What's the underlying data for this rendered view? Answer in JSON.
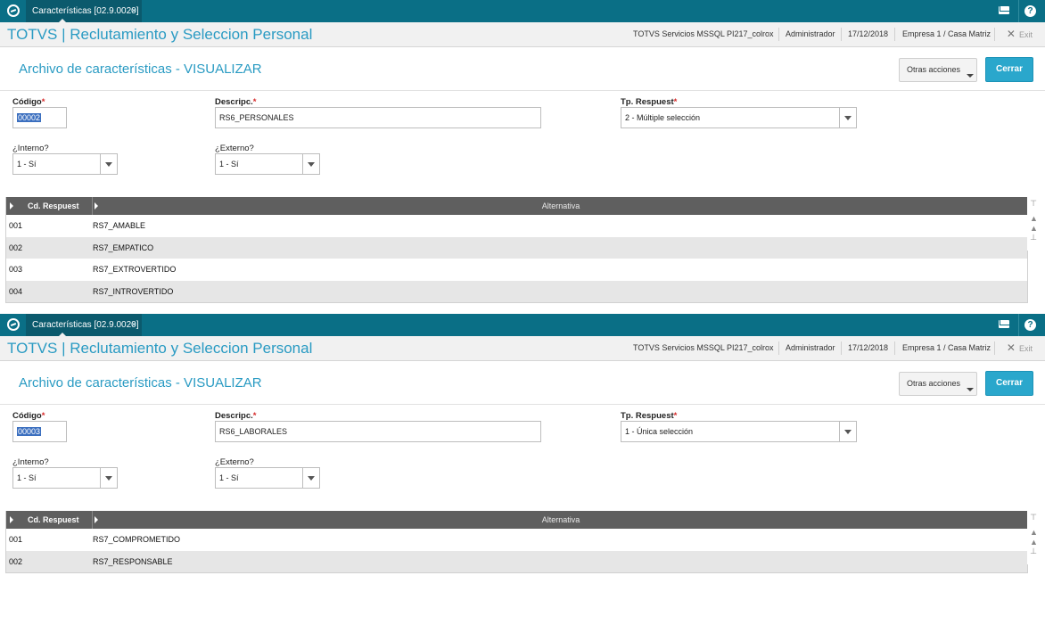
{
  "colors": {
    "topbar": "#0a6f86",
    "accent": "#2a9bc3",
    "primary_button": "#2aa7cc",
    "grid_header": "#5f5f5f"
  },
  "screens": [
    {
      "tab_label": "Características [02.9.0020]",
      "tab_close": "×",
      "app_title": "TOTVS | Reclutamiento y Seleccion Personal",
      "env": "TOTVS Servicios MSSQL PI217_colrox",
      "user": "Administrador",
      "date": "17/12/2018",
      "company": "Empresa 1 / Casa Matriz",
      "exit": "Exit",
      "page_title": "Archivo de características - VISUALIZAR",
      "other_actions": "Otras acciones",
      "close": "Cerrar",
      "codigo_label": "Código",
      "codigo_value": "00002",
      "descripc_label": "Descripc.",
      "descripc_value": "RS6_PERSONALES",
      "tp_label": "Tp. Respuest",
      "tp_value": "2 - Múltiple selección",
      "interno_label": "¿Interno?",
      "interno_value": "1 - Sí",
      "externo_label": "¿Externo?",
      "externo_value": "1 - Sí",
      "required_mark": "*",
      "grid_headers": [
        "Cd. Respuest",
        "Alternativa"
      ],
      "rows": [
        [
          "001",
          "RS7_AMABLE"
        ],
        [
          "002",
          "RS7_EMPATICO"
        ],
        [
          "003",
          "RS7_EXTROVERTIDO"
        ],
        [
          "004",
          "RS7_INTROVERTIDO"
        ]
      ]
    },
    {
      "tab_label": "Características [02.9.0020]",
      "tab_close": "×",
      "app_title": "TOTVS | Reclutamiento y Seleccion Personal",
      "env": "TOTVS Servicios MSSQL PI217_colrox",
      "user": "Administrador",
      "date": "17/12/2018",
      "company": "Empresa 1 / Casa Matriz",
      "exit": "Exit",
      "page_title": "Archivo de características - VISUALIZAR",
      "other_actions": "Otras acciones",
      "close": "Cerrar",
      "codigo_label": "Código",
      "codigo_value": "00003",
      "descripc_label": "Descripc.",
      "descripc_value": "RS6_LABORALES",
      "tp_label": "Tp. Respuest",
      "tp_value": "1 - Única selección",
      "interno_label": "¿Interno?",
      "interno_value": "1 - Sí",
      "externo_label": "¿Externo?",
      "externo_value": "1 - Sí",
      "required_mark": "*",
      "grid_headers": [
        "Cd. Respuest",
        "Alternativa"
      ],
      "rows": [
        [
          "001",
          "RS7_COMPROMETIDO"
        ],
        [
          "002",
          "RS7_RESPONSABLE"
        ]
      ]
    }
  ]
}
